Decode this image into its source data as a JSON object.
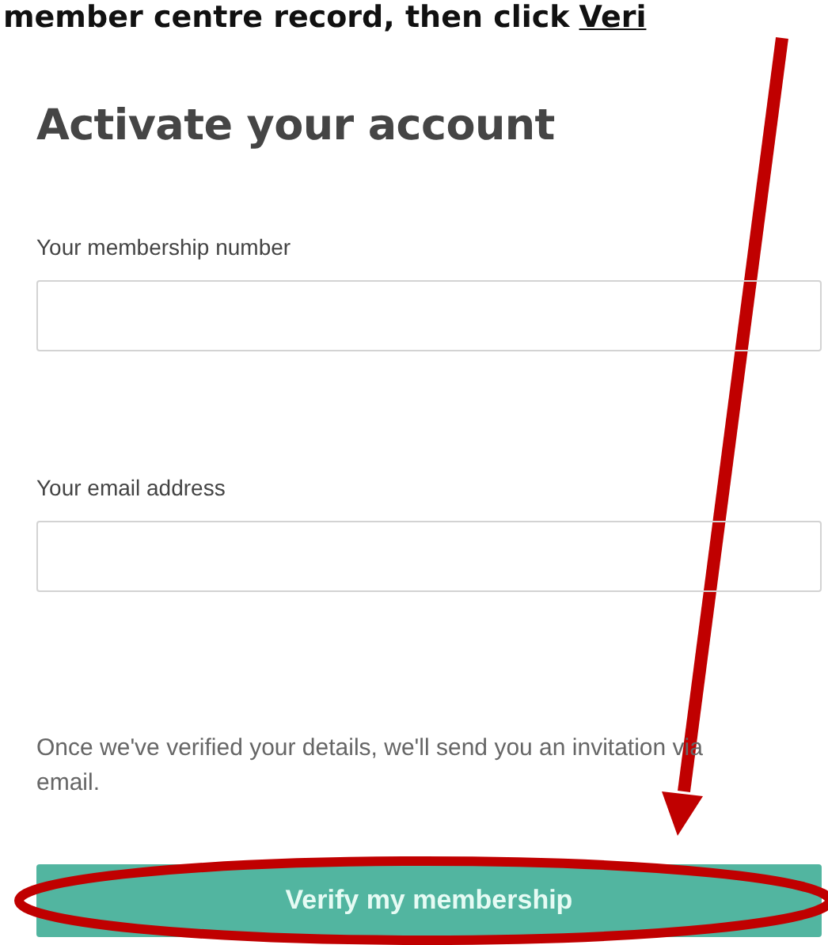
{
  "instruction": {
    "text": "member centre record, then click",
    "link": "Veri"
  },
  "form": {
    "title": "Activate your account",
    "fields": [
      {
        "label": "Your membership number"
      },
      {
        "label": "Your email address"
      }
    ],
    "note": "Once we've verified your details, we'll send you an invitation via email.",
    "button": "Verify my membership"
  },
  "annotations": {
    "pointer_arrow": true,
    "highlight_ellipse": true
  }
}
